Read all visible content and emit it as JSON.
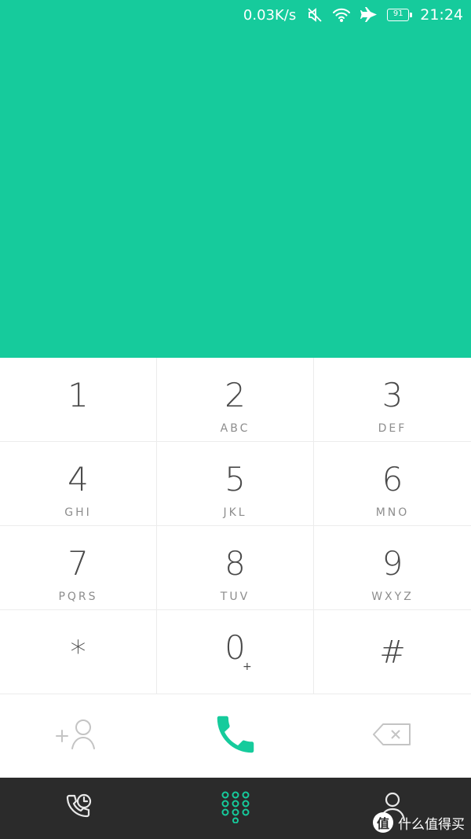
{
  "colors": {
    "accent": "#16cb9c",
    "nav_bg": "#2b2b2b",
    "digit": "#4a4a4a",
    "letters": "#8d8d8d"
  },
  "status_bar": {
    "net_speed": "0.03K/s",
    "battery": "91",
    "time": "21:24",
    "icons": [
      "mute-icon",
      "wifi-icon",
      "airplane-icon",
      "battery-icon"
    ]
  },
  "keypad": {
    "keys": [
      {
        "digit": "1",
        "letters": ""
      },
      {
        "digit": "2",
        "letters": "ABC"
      },
      {
        "digit": "3",
        "letters": "DEF"
      },
      {
        "digit": "4",
        "letters": "GHI"
      },
      {
        "digit": "5",
        "letters": "JKL"
      },
      {
        "digit": "6",
        "letters": "MNO"
      },
      {
        "digit": "7",
        "letters": "PQRS"
      },
      {
        "digit": "8",
        "letters": "TUV"
      },
      {
        "digit": "9",
        "letters": "WXYZ"
      },
      {
        "digit": "*",
        "letters": ""
      },
      {
        "digit": "0",
        "letters": "+"
      },
      {
        "digit": "#",
        "letters": ""
      }
    ]
  },
  "actions": {
    "icons": [
      "add-contact-icon",
      "call-icon",
      "backspace-icon"
    ]
  },
  "nav": {
    "icons": [
      "call-log-icon",
      "dialpad-icon",
      "contacts-icon"
    ]
  },
  "watermark": {
    "logo": "值",
    "text": "什么值得买"
  }
}
